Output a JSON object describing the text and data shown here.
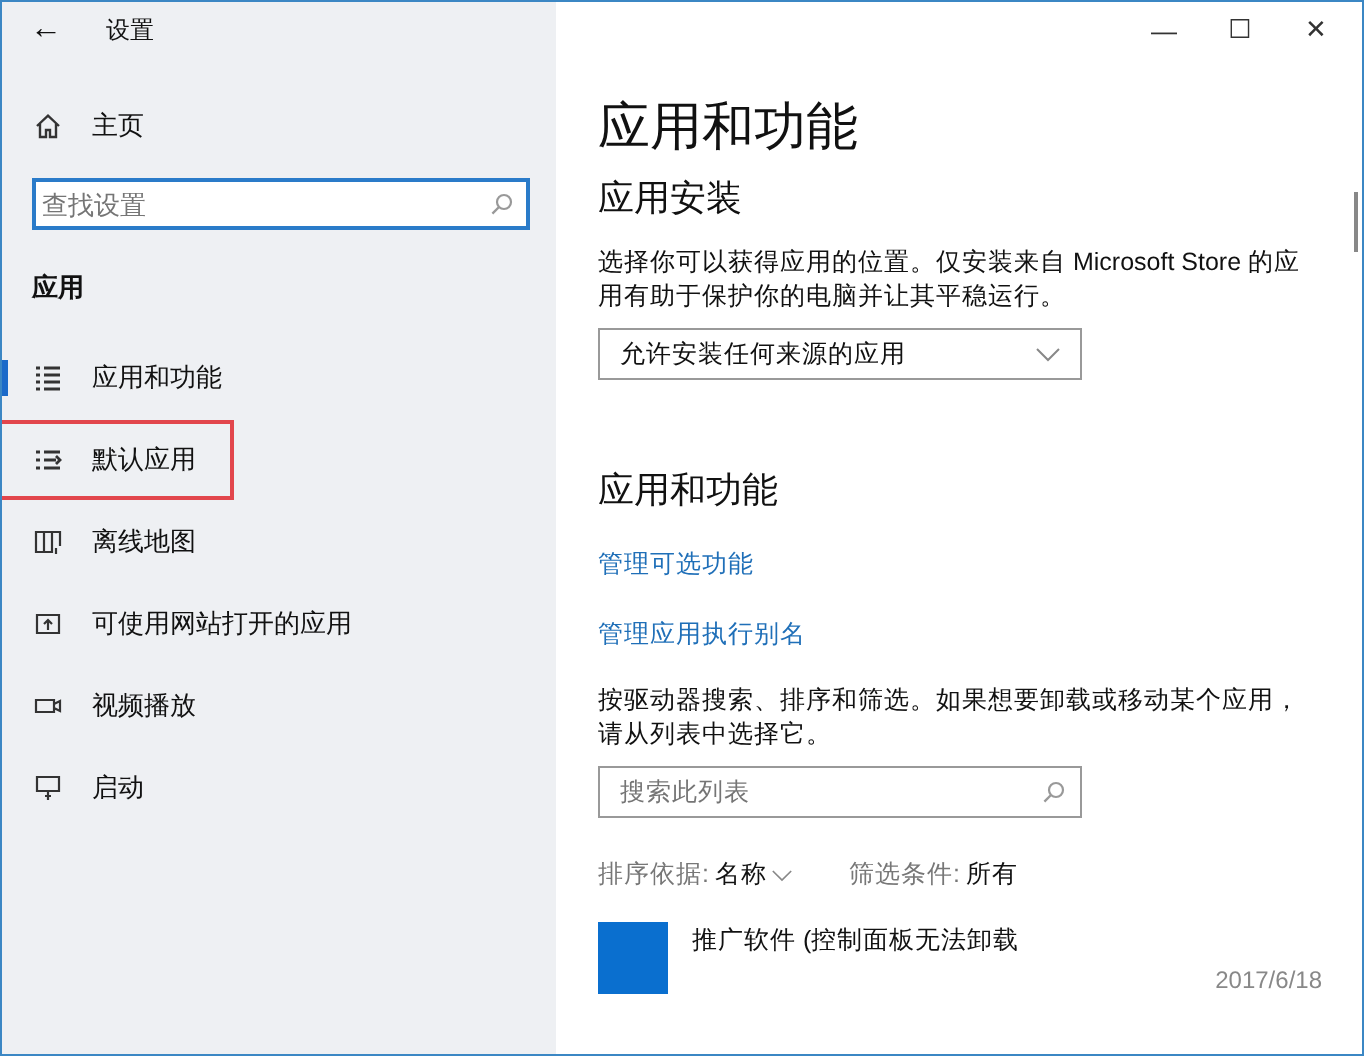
{
  "window": {
    "title": "设置",
    "back": "←",
    "controls": [
      "—",
      "☐",
      "✕"
    ]
  },
  "sidebar": {
    "home": "主页",
    "search": {
      "placeholder": "查找设置"
    },
    "section": "应用",
    "items": [
      {
        "label": "应用和功能",
        "kind": "list",
        "selected": true,
        "highlighted": false
      },
      {
        "label": "默认应用",
        "kind": "default",
        "selected": false,
        "highlighted": true
      },
      {
        "label": "离线地图",
        "kind": "map",
        "selected": false,
        "highlighted": false
      },
      {
        "label": "可使用网站打开的应用",
        "kind": "web",
        "selected": false,
        "highlighted": false
      },
      {
        "label": "视频播放",
        "kind": "video",
        "selected": false,
        "highlighted": false
      },
      {
        "label": "启动",
        "kind": "startup",
        "selected": false,
        "highlighted": false
      }
    ]
  },
  "main": {
    "title": "应用和功能",
    "install_heading": "应用安装",
    "install_text": "选择你可以获得应用的位置。仅安装来自 Microsoft Store 的应用有助于保护你的电脑并让其平稳运行。",
    "install_dropdown": "允许安装任何来源的应用",
    "apps_heading": "应用和功能",
    "links": [
      "管理可选功能",
      "管理应用执行别名"
    ],
    "apps_text": "按驱动器搜索、排序和筛选。如果想要卸载或移动某个应用，请从列表中选择它。",
    "list_search": {
      "placeholder": "搜索此列表"
    },
    "sort": {
      "label": "排序依据:",
      "value": "名称"
    },
    "filter": {
      "label": "筛选条件:",
      "value": "所有"
    },
    "apps": [
      {
        "name": "推广软件 (控制面板无法卸载",
        "date": "2017/6/18",
        "color": "#0a6fcf"
      }
    ]
  }
}
